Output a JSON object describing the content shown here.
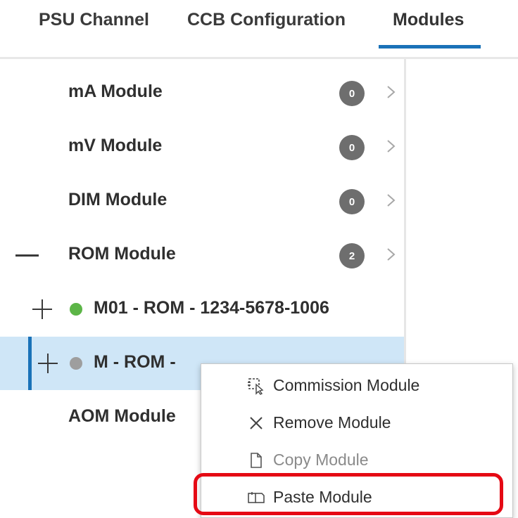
{
  "tabs": {
    "psu_channel": "PSU Channel",
    "ccb_configuration": "CCB Configuration",
    "modules": "Modules",
    "active": "Modules"
  },
  "tree": {
    "ma_module": {
      "label": "mA Module",
      "count": "0"
    },
    "mv_module": {
      "label": "mV Module",
      "count": "0"
    },
    "dim_module": {
      "label": "DIM Module",
      "count": "0"
    },
    "rom_module": {
      "label": "ROM Module",
      "count": "2"
    },
    "rom_child_1": {
      "label": "M01 - ROM - 1234-5678-1006",
      "status": "commissioned",
      "status_color": "#5cb547"
    },
    "rom_child_2": {
      "label": "M - ROM -",
      "status": "uncommissioned",
      "status_color": "#9e9e9e",
      "selected": true
    },
    "aom_module": {
      "label": "AOM Module"
    }
  },
  "context_menu": {
    "items": [
      {
        "label": "Commission Module",
        "icon": "commission-icon",
        "enabled": true
      },
      {
        "label": "Remove Module",
        "icon": "close-icon",
        "enabled": true
      },
      {
        "label": "Copy Module",
        "icon": "copy-icon",
        "enabled": false
      },
      {
        "label": "Paste Module",
        "icon": "paste-icon",
        "enabled": true,
        "highlighted": true
      }
    ]
  },
  "colors": {
    "accent": "#1a72b8",
    "selection_bg": "#cfe6f7",
    "badge": "#6e6e6e",
    "highlight": "#e50914"
  }
}
